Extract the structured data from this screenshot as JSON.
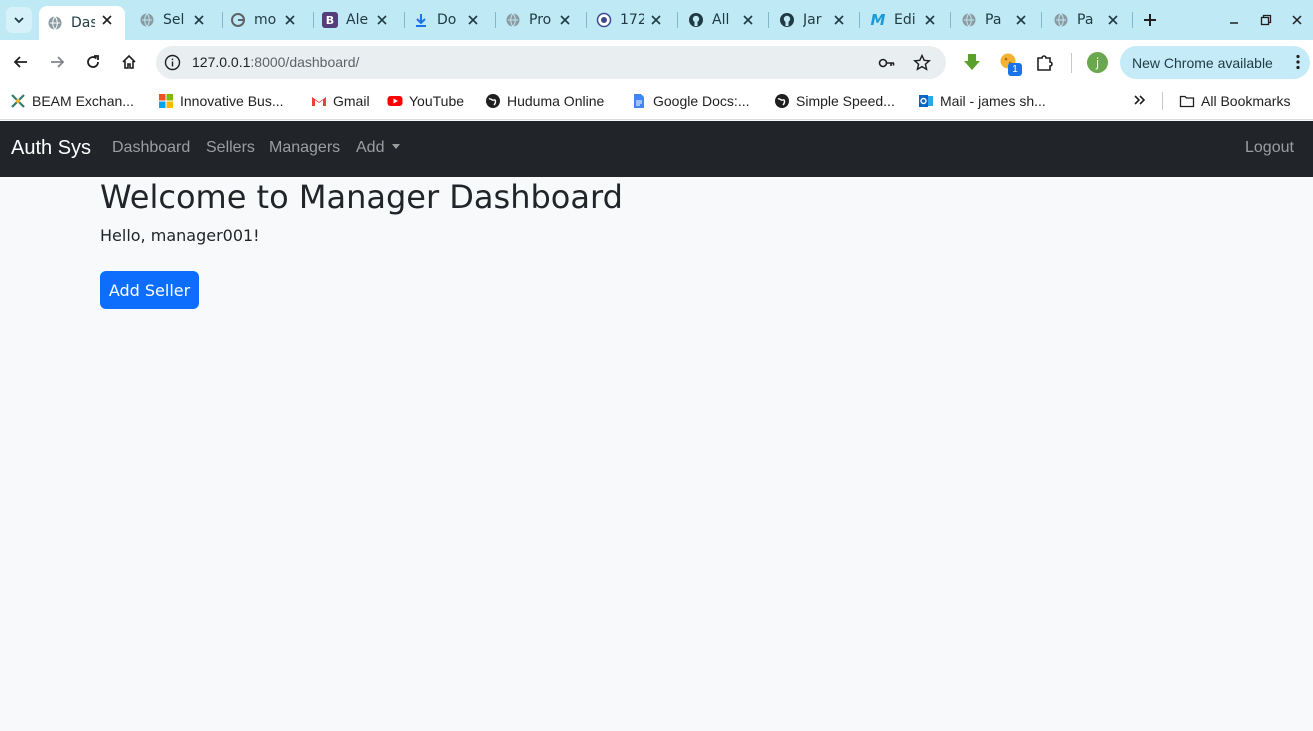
{
  "browser": {
    "tabs": [
      {
        "label": "Das",
        "favicon": "globe-icon",
        "active": true
      },
      {
        "label": "Sel",
        "favicon": "globe-icon"
      },
      {
        "label": "mo",
        "favicon": "google-icon"
      },
      {
        "label": "Ale",
        "favicon": "bootstrap-icon"
      },
      {
        "label": "Do",
        "favicon": "download-icon"
      },
      {
        "label": "Pro",
        "favicon": "globe-icon"
      },
      {
        "label": "172",
        "favicon": "globe-icon"
      },
      {
        "label": "All",
        "favicon": "github-icon"
      },
      {
        "label": "Jar",
        "favicon": "github-icon"
      },
      {
        "label": "Edi",
        "favicon": "m-icon"
      },
      {
        "label": "Pa",
        "favicon": "globe-icon"
      },
      {
        "label": "Pa",
        "favicon": "globe-icon"
      }
    ],
    "url_host": "127.0.0.1",
    "url_path": ":8000/dashboard/",
    "update_label": "New Chrome available",
    "extension_badge": "1",
    "profile_initial": "j",
    "bookmarks": [
      {
        "label": "BEAM Exchan...",
        "icon": "beam-icon"
      },
      {
        "label": "Innovative Bus...",
        "icon": "microsoft-icon"
      },
      {
        "label": "Gmail",
        "icon": "gmail-icon"
      },
      {
        "label": "YouTube",
        "icon": "youtube-icon"
      },
      {
        "label": "Huduma Online",
        "icon": "globe-icon"
      },
      {
        "label": "Google Docs:...",
        "icon": "docs-icon"
      },
      {
        "label": "Simple Speed...",
        "icon": "globe-icon"
      },
      {
        "label": "Mail - james sh...",
        "icon": "outlook-icon"
      }
    ],
    "all_bookmarks_label": "All Bookmarks"
  },
  "navbar": {
    "brand": "Auth Sys",
    "links": [
      "Dashboard",
      "Sellers",
      "Managers",
      "Add"
    ],
    "logout": "Logout"
  },
  "main": {
    "heading": "Welcome to Manager Dashboard",
    "greeting": "Hello, manager001!",
    "add_seller_label": "Add Seller"
  },
  "colors": {
    "tabstrip": "#bfe9f5",
    "navbar": "#212529",
    "primary_button": "#0d6efd",
    "page_bg": "#f8f9fa"
  }
}
